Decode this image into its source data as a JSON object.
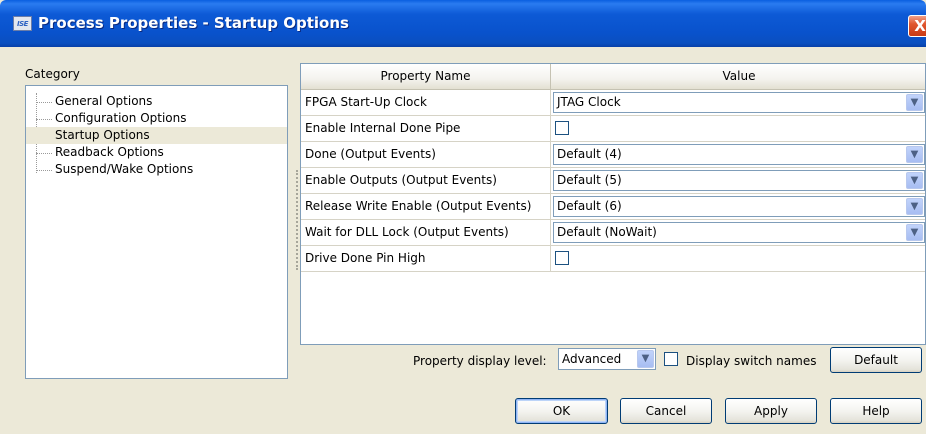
{
  "window": {
    "title": "Process Properties - Startup Options",
    "icon_text": "ISE",
    "close_label": "X"
  },
  "category": {
    "label": "Category",
    "items": [
      {
        "label": "General Options"
      },
      {
        "label": "Configuration Options"
      },
      {
        "label": "Startup Options",
        "selected": true
      },
      {
        "label": "Readback Options"
      },
      {
        "label": "Suspend/Wake Options"
      }
    ]
  },
  "grid": {
    "headers": {
      "name": "Property Name",
      "value": "Value"
    },
    "rows": [
      {
        "name": "FPGA Start-Up Clock",
        "type": "combo",
        "value": "JTAG Clock"
      },
      {
        "name": "Enable Internal Done Pipe",
        "type": "checkbox",
        "checked": false
      },
      {
        "name": "Done (Output Events)",
        "type": "combo",
        "value": "Default (4)"
      },
      {
        "name": "Enable Outputs (Output Events)",
        "type": "combo",
        "value": "Default (5)"
      },
      {
        "name": "Release Write Enable (Output Events)",
        "type": "combo",
        "value": "Default (6)"
      },
      {
        "name": "Wait for DLL Lock (Output Events)",
        "type": "combo",
        "value": "Default (NoWait)"
      },
      {
        "name": "Drive Done Pin High",
        "type": "checkbox",
        "checked": false
      }
    ]
  },
  "footer": {
    "level_label": "Property display level:",
    "level_value": "Advanced",
    "switch_names_label": "Display switch names",
    "switch_names_checked": false,
    "default_button": "Default",
    "ok_button": "OK",
    "cancel_button": "Cancel",
    "apply_button": "Apply",
    "help_button": "Help"
  },
  "icons": {
    "dropdown": "chevron-down-icon",
    "app": "ise-app-icon",
    "close": "close-icon"
  },
  "colors": {
    "titlebar": "#0a55d0",
    "window_bg": "#ece9d8",
    "field_border": "#7f9db9"
  }
}
